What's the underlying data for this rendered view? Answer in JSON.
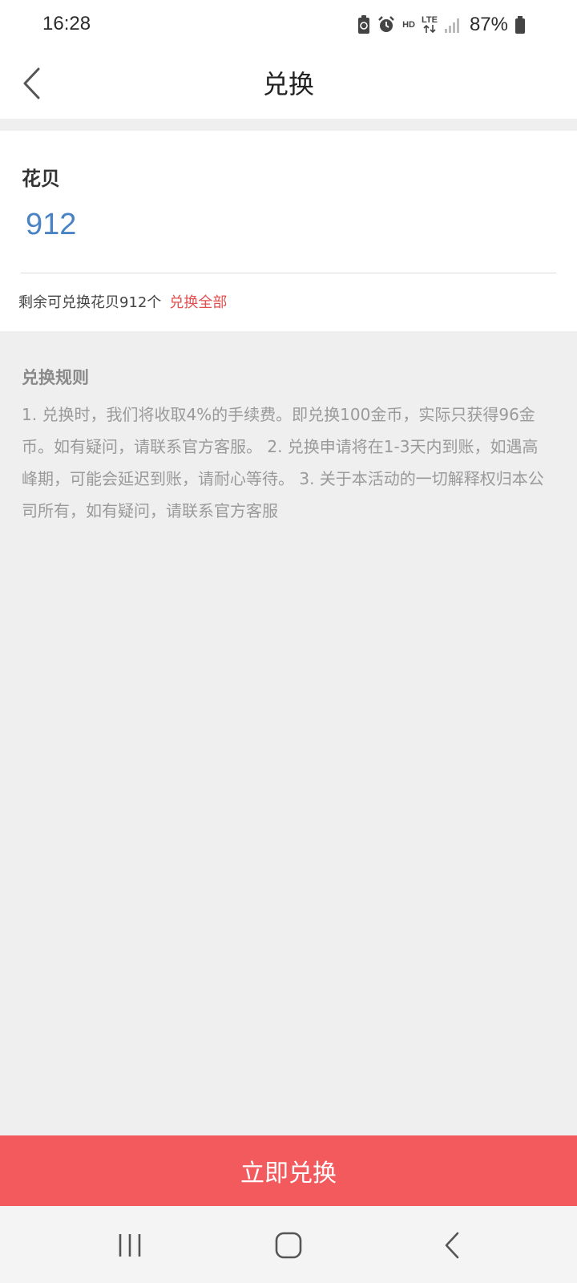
{
  "status_bar": {
    "time": "16:28",
    "icons": [
      "battery-saver-icon",
      "alarm-icon",
      "hd-icon",
      "lte-icon",
      "signal-icon"
    ],
    "hd_text": "HD",
    "lte_text": "LTE",
    "battery_text": "87%"
  },
  "nav": {
    "title": "兑换",
    "back_icon": "chevron-left-icon"
  },
  "form": {
    "label": "花贝",
    "value": "912",
    "remaining_text": "剩余可兑换花贝912个",
    "exchange_all": "兑换全部"
  },
  "rules": {
    "title": "兑换规则",
    "text": "1. 兑换时，我们将收取4%的手续费。即兑换100金币，实际只获得96金币。如有疑问，请联系官方客服。 2. 兑换申请将在1-3天内到账，如遇高峰期，可能会延迟到账，请耐心等待。 3. 关于本活动的一切解释权归本公司所有，如有疑问，请联系官方客服"
  },
  "submit_label": "立即兑换",
  "colors": {
    "accent": "#f35a5e",
    "link_red": "#e0504f",
    "value_blue": "#4a83c4",
    "background": "#efefef"
  },
  "system_nav": {
    "icons": [
      "recent-apps-icon",
      "home-icon",
      "back-icon"
    ]
  }
}
